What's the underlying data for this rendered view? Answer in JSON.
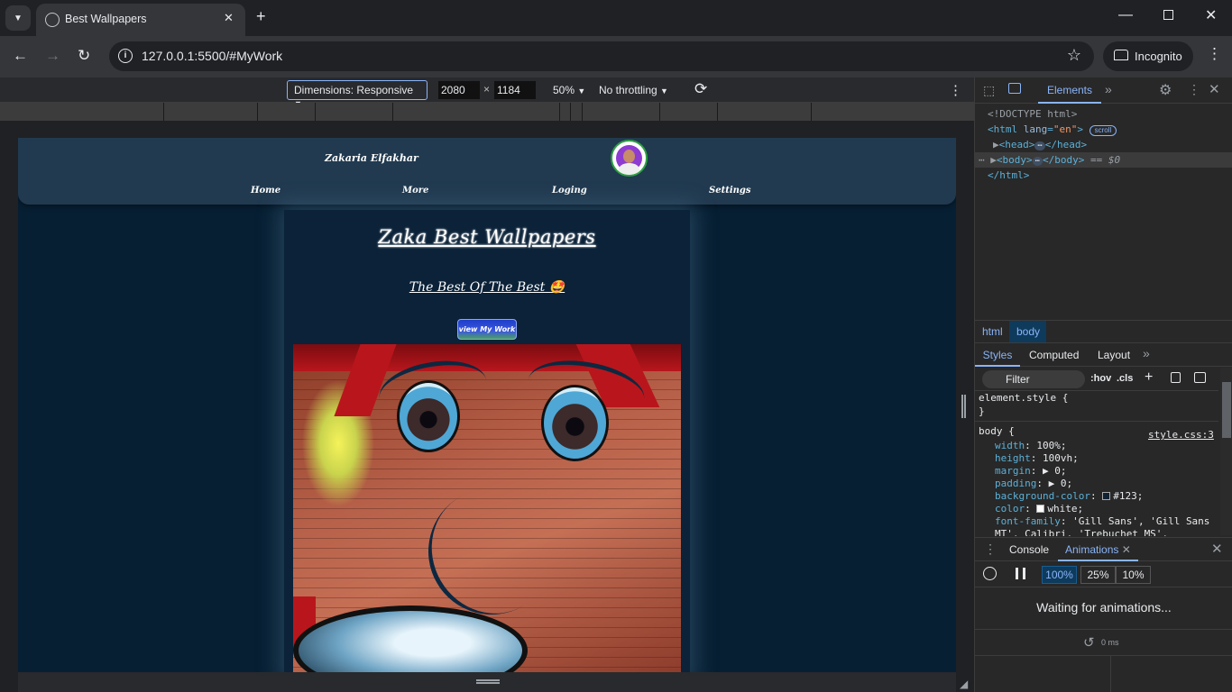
{
  "browser": {
    "tab_title": "Best Wallpapers",
    "url": "127.0.0.1:5500/#MyWork",
    "incognito_label": "Incognito"
  },
  "device_toolbar": {
    "dimensions_label": "Dimensions: Responsive",
    "width": "2080",
    "height": "1184",
    "times": "×",
    "zoom": "50%",
    "throttling": "No throttling"
  },
  "site": {
    "author": "Zakaria Elfakhar",
    "nav": [
      "Home",
      "More",
      "Loging",
      "Settings"
    ],
    "title": "Zaka Best Wallpapers",
    "subtitle": "The Best Of The Best 🤩",
    "button": "view My Work"
  },
  "devtools": {
    "tabs": {
      "elements": "Elements"
    },
    "dom": {
      "doctype": "<!DOCTYPE html>",
      "html_open_tag": "<html",
      "html_lang_attr": "lang",
      "html_lang_val": "\"en\"",
      "html_close_bracket": ">",
      "scroll_badge": "scroll",
      "head": "<head>",
      "head_close": "</head>",
      "body": "<body>",
      "body_close": "</body>",
      "body_sel": "== $0",
      "html_close": "</html>",
      "ellipsis": "⋯"
    },
    "breadcrumbs": [
      "html",
      "body"
    ],
    "styles_tabs": [
      "Styles",
      "Computed",
      "Layout"
    ],
    "filter_placeholder": "Filter",
    "hov": ":hov",
    "cls": ".cls",
    "styles": {
      "element_style_open": "element.style {",
      "close_brace": "}",
      "body_selector": "body {",
      "source": "style.css:3",
      "rules": [
        {
          "prop": "width",
          "value": "100%;"
        },
        {
          "prop": "height",
          "value": "100vh;"
        },
        {
          "prop": "margin",
          "value": "▶ 0;"
        },
        {
          "prop": "padding",
          "value": "▶ 0;"
        },
        {
          "prop": "background-color",
          "value": "#123;",
          "swatch": "#112233"
        },
        {
          "prop": "color",
          "value": "white;",
          "swatch": "#ffffff"
        },
        {
          "prop": "font-family",
          "value": "'Gill Sans', 'Gill Sans"
        },
        {
          "prop": "",
          "value": "  MT', Calibri, 'Trebuchet MS',"
        }
      ]
    },
    "drawer": {
      "console": "Console",
      "animations": "Animations",
      "speeds": [
        "100%",
        "25%",
        "10%"
      ],
      "waiting": "Waiting for animations...",
      "time": "0 ms"
    }
  }
}
